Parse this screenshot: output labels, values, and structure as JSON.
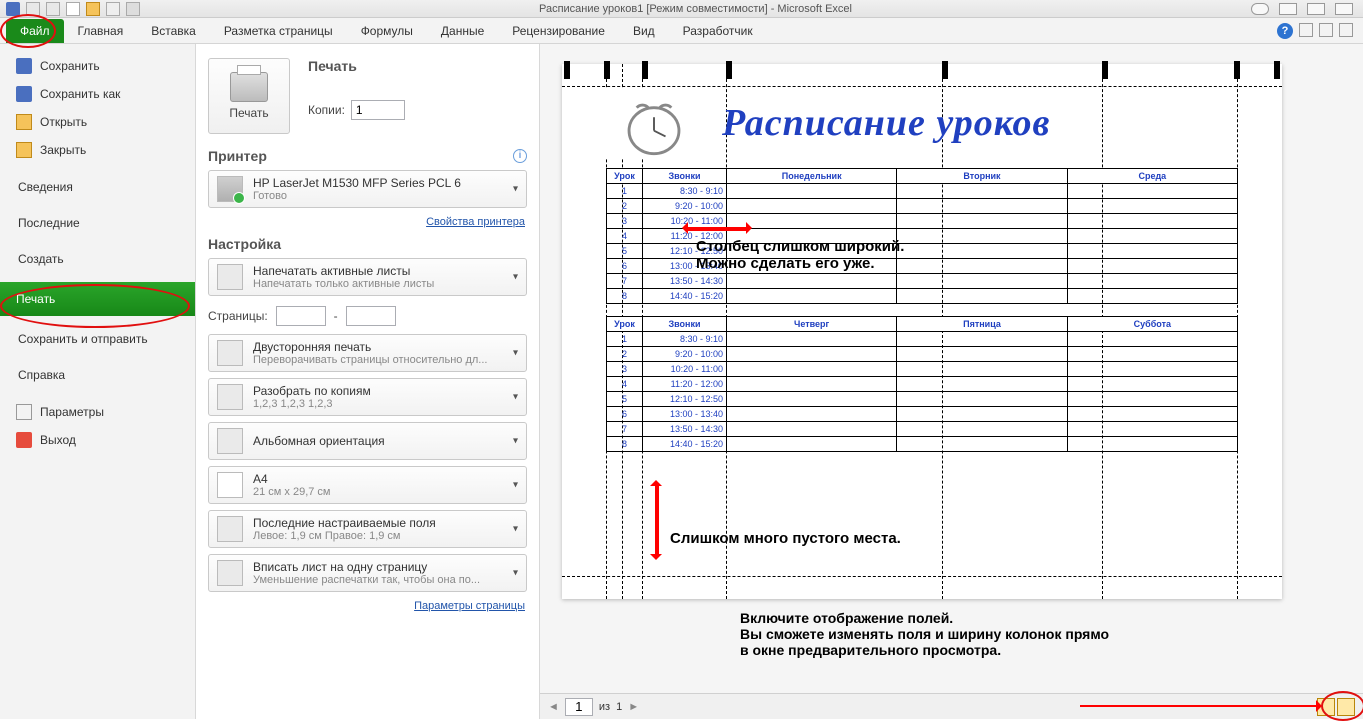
{
  "titlebar": {
    "document": "Расписание уроков1  [Режим совместимости]  -  Microsoft Excel"
  },
  "ribbon": {
    "tabs": [
      "Файл",
      "Главная",
      "Вставка",
      "Разметка страницы",
      "Формулы",
      "Данные",
      "Рецензирование",
      "Вид",
      "Разработчик"
    ]
  },
  "sidebar": {
    "save": "Сохранить",
    "saveas": "Сохранить как",
    "open": "Открыть",
    "close": "Закрыть",
    "info": "Сведения",
    "recent": "Последние",
    "new": "Создать",
    "print": "Печать",
    "share": "Сохранить и отправить",
    "help": "Справка",
    "options": "Параметры",
    "exit": "Выход"
  },
  "center": {
    "print_header": "Печать",
    "print_button": "Печать",
    "copies_label": "Копии:",
    "copies_value": "1",
    "printer_header": "Принтер",
    "printer_name": "HP LaserJet M1530 MFP Series PCL 6",
    "printer_status": "Готово",
    "printer_props": "Свойства принтера",
    "settings_header": "Настройка",
    "scope_t1": "Напечатать активные листы",
    "scope_t2": "Напечатать только активные листы",
    "pages_label": "Страницы:",
    "pages_sep": "-",
    "duplex_t1": "Двусторонняя печать",
    "duplex_t2": "Переворачивать страницы относительно дл...",
    "collate_t1": "Разобрать по копиям",
    "collate_t2": "1,2,3   1,2,3   1,2,3",
    "orient_t1": "Альбомная ориентация",
    "size_t1": "A4",
    "size_t2": "21 см x 29,7 см",
    "margins_t1": "Последние настраиваемые поля",
    "margins_t2": "Левое: 1,9 см   Правое: 1,9 см",
    "fit_t1": "Вписать лист на одну страницу",
    "fit_t2": "Уменьшение распечатки так, чтобы она по...",
    "page_setup": "Параметры страницы"
  },
  "preview": {
    "title": "Расписание уроков",
    "headers1": [
      "Урок",
      "Звонки",
      "Понедельник",
      "Вторник",
      "Среда"
    ],
    "headers2": [
      "Урок",
      "Звонки",
      "Четверг",
      "Пятница",
      "Суббота"
    ],
    "rows": [
      {
        "n": "1",
        "t": "8:30 - 9:10"
      },
      {
        "n": "2",
        "t": "9:20 - 10:00"
      },
      {
        "n": "3",
        "t": "10:20 - 11:00"
      },
      {
        "n": "4",
        "t": "11:20 - 12:00"
      },
      {
        "n": "5",
        "t": "12:10 - 12:50"
      },
      {
        "n": "6",
        "t": "13:00 - 13:40"
      },
      {
        "n": "7",
        "t": "13:50 - 14:30"
      },
      {
        "n": "8",
        "t": "14:40 - 15:20"
      }
    ]
  },
  "annotations": {
    "col_wide_1": "Столбец слишком широкий.",
    "col_wide_2": "Можно сделать его уже.",
    "empty_space": "Слишком много пустого места.",
    "margins_1": "Включите отображение полей.",
    "margins_2": "Вы сможете изменять поля и ширину колонок прямо",
    "margins_3": "в окне предварительного просмотра."
  },
  "status": {
    "page_cur": "1",
    "page_total_prefix": "из",
    "page_total": "1"
  }
}
